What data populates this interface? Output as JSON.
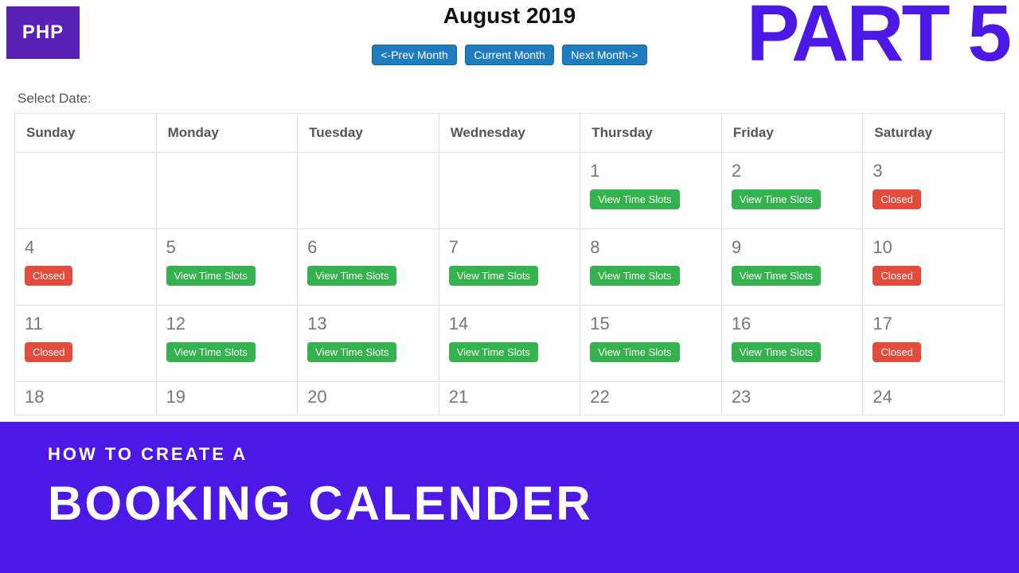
{
  "badge": {
    "label": "PHP"
  },
  "title": "August 2019",
  "part_label": "PART 5",
  "nav": {
    "prev": "<-Prev Month",
    "current": "Current Month",
    "next": "Next Month->"
  },
  "select_label": "Select Date:",
  "day_headers": [
    "Sunday",
    "Monday",
    "Tuesday",
    "Wednesday",
    "Thursday",
    "Friday",
    "Saturday"
  ],
  "labels": {
    "view_slots": "View Time Slots",
    "closed": "Closed"
  },
  "weeks": [
    [
      {
        "day": ""
      },
      {
        "day": ""
      },
      {
        "day": ""
      },
      {
        "day": ""
      },
      {
        "day": "1",
        "status": "open"
      },
      {
        "day": "2",
        "status": "open"
      },
      {
        "day": "3",
        "status": "closed"
      }
    ],
    [
      {
        "day": "4",
        "status": "closed"
      },
      {
        "day": "5",
        "status": "open"
      },
      {
        "day": "6",
        "status": "open"
      },
      {
        "day": "7",
        "status": "open"
      },
      {
        "day": "8",
        "status": "open"
      },
      {
        "day": "9",
        "status": "open"
      },
      {
        "day": "10",
        "status": "closed"
      }
    ],
    [
      {
        "day": "11",
        "status": "closed"
      },
      {
        "day": "12",
        "status": "open"
      },
      {
        "day": "13",
        "status": "open"
      },
      {
        "day": "14",
        "status": "open"
      },
      {
        "day": "15",
        "status": "open"
      },
      {
        "day": "16",
        "status": "open"
      },
      {
        "day": "17",
        "status": "closed"
      }
    ],
    [
      {
        "day": "18"
      },
      {
        "day": "19"
      },
      {
        "day": "20"
      },
      {
        "day": "21"
      },
      {
        "day": "22"
      },
      {
        "day": "23"
      },
      {
        "day": "24"
      }
    ]
  ],
  "overlay": {
    "kicker": "HOW TO CREATE A",
    "headline": "BOOKING CALENDER"
  }
}
